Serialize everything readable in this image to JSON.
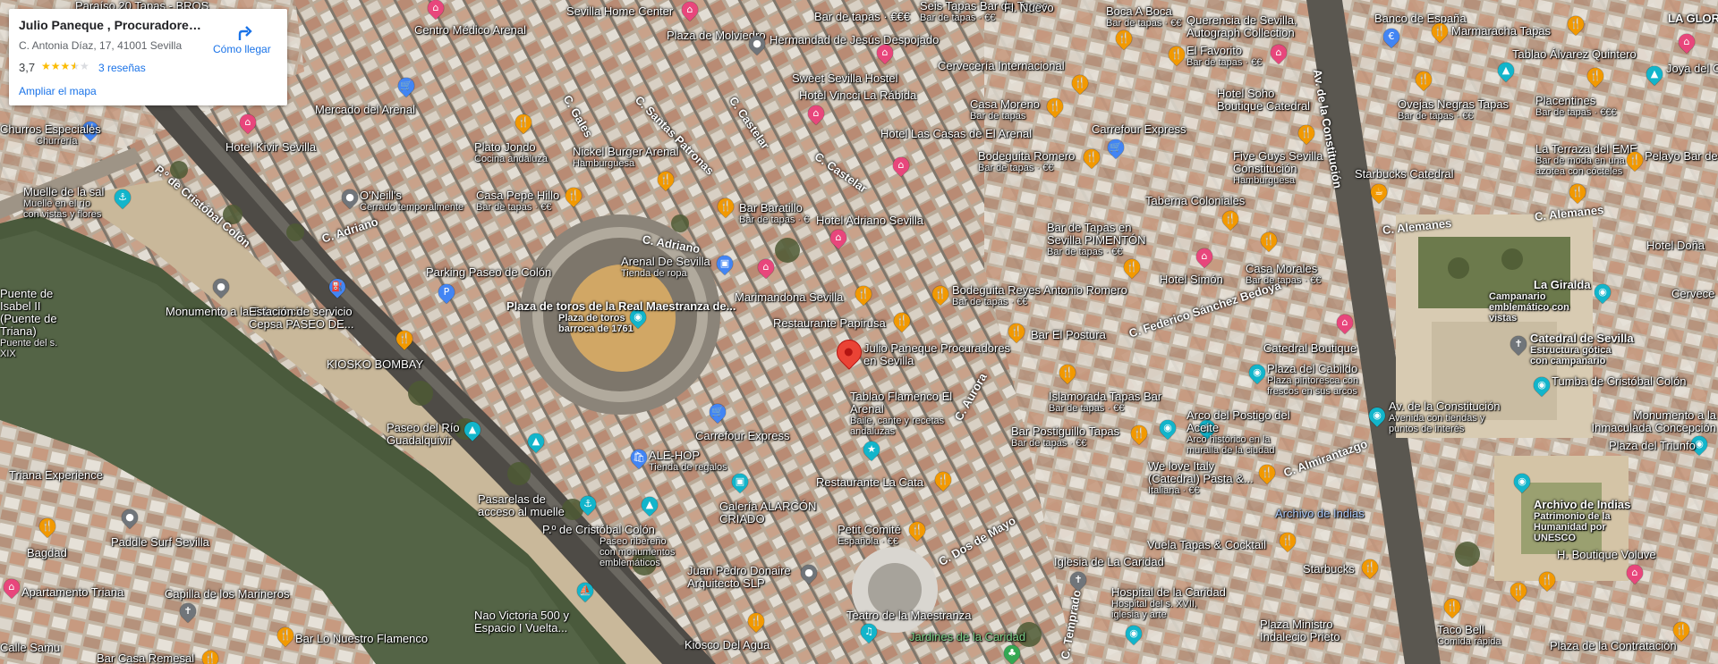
{
  "place_card": {
    "title": "Julio Paneque , Procuradores ...",
    "address": "C. Antonia Díaz, 17, 41001 Sevilla",
    "rating": "3,7",
    "stars_filled": 3.5,
    "reviews": "3 reseñas",
    "enlarge_map": "Ampliar el mapa",
    "directions": "Cómo llegar"
  },
  "colors": {
    "food_pin": "#f29900",
    "shop_pin": "#4285f4",
    "tourism_pin": "#12b5cb",
    "hotel_pin": "#e8467c",
    "generic_pin": "#70757a",
    "main_pin": "#ea4335"
  },
  "map": {
    "streets": [
      "P.º de Cristóbal Colón",
      "C. Adriano",
      "C. Adriano",
      "C. Gales",
      "C. Santas Patronas",
      "C. Castelar",
      "C. Castelar",
      "C. Federico Sánchez Bedoya",
      "Av. de la Constitución",
      "C. Alemanes",
      "C. Alemanes",
      "C. Dos de Mayo",
      "C. Aurora",
      "C. Almirantazgo",
      "C. Temprado"
    ],
    "places": [
      {
        "name": "Centro Médico Arenal",
        "sub": "",
        "icon": "generic"
      },
      {
        "name": "Sevilla Home Center",
        "sub": "",
        "icon": "hotel"
      },
      {
        "name": "Plaza de Molviedro",
        "sub": "",
        "icon": "generic"
      },
      {
        "name": "Hermandad de Jesús Despojado",
        "sub": "",
        "icon": "generic"
      },
      {
        "name": "Sweet Sevilla Hostel",
        "sub": "",
        "icon": "hotel"
      },
      {
        "name": "Hotel Vincci La Rábida",
        "sub": "",
        "icon": "hotel"
      },
      {
        "name": "Cervecería Internacional",
        "sub": "",
        "icon": "food"
      },
      {
        "name": "Casa Moreno",
        "sub": "Bar de tapas",
        "icon": "food"
      },
      {
        "name": "Hotel Las Casas de El Arenal",
        "sub": "",
        "icon": "hotel"
      },
      {
        "name": "Bodeguita Romero",
        "sub": "Bar de tapas · €€",
        "icon": "food"
      },
      {
        "name": "Carrefour Express",
        "sub": "",
        "icon": "shop"
      },
      {
        "name": "Mercado del Arenal",
        "sub": "",
        "icon": "shop"
      },
      {
        "name": "Hotel Kivir Sevilla",
        "sub": "",
        "icon": "hotel"
      },
      {
        "name": "Plato Jondo",
        "sub": "Cocina andaluza",
        "icon": "food"
      },
      {
        "name": "Nickel Burger Arenal",
        "sub": "Hamburguesa",
        "icon": "food"
      },
      {
        "name": "O'Neill's",
        "sub": "Cerrado temporalmente",
        "icon": "generic"
      },
      {
        "name": "Casa Pepe Hillo",
        "sub": "Bar de tapas · €€",
        "icon": "food"
      },
      {
        "name": "Bar Baratillo",
        "sub": "Bar de tapas · €",
        "icon": "food"
      },
      {
        "name": "Hotel Adriano Sevilla",
        "sub": "",
        "icon": "hotel"
      },
      {
        "name": "Parking Paseo de Colón",
        "sub": "",
        "icon": "shop"
      },
      {
        "name": "Arenal De Sevilla",
        "sub": "Tienda de ropa",
        "icon": "shop"
      },
      {
        "name": "Plaza de toros de la Real Maestranza de...",
        "sub": "Plaza de toros barroca de 1761",
        "icon": "tourism"
      },
      {
        "name": "Marimandona Sevilla",
        "sub": "",
        "icon": "hotel"
      },
      {
        "name": "Bodeguita Reyes Antonio Romero",
        "sub": "Bar de tapas · €€",
        "icon": "food"
      },
      {
        "name": "Restaurante Papirusa",
        "sub": "",
        "icon": "food"
      },
      {
        "name": "Bar El Postura",
        "sub": "",
        "icon": "food"
      },
      {
        "name": "Julio Paneque Procuradores en Sevilla",
        "sub": "",
        "icon": "main"
      },
      {
        "name": "Tablao Flamenco El Arenal",
        "sub": "Baile, cante y recetas andaluzas",
        "icon": "tourism"
      },
      {
        "name": "Carrefour Express",
        "sub": "",
        "icon": "shop"
      },
      {
        "name": "ALE-HOP",
        "sub": "Tienda de regalos",
        "icon": "shop"
      },
      {
        "name": "Restaurante La Cata",
        "sub": "",
        "icon": "food"
      },
      {
        "name": "Galería ALARCÓN CRIADO",
        "sub": "",
        "icon": "tourism"
      },
      {
        "name": "Petit Comité",
        "sub": "Española · €€",
        "icon": "food"
      },
      {
        "name": "Monumento a la Tolerancia",
        "sub": "",
        "icon": "generic"
      },
      {
        "name": "Estación de servicio Cepsa PASEO DE...",
        "sub": "",
        "icon": "shop"
      },
      {
        "name": "KIOSKO BOMBAY",
        "sub": "",
        "icon": "food"
      },
      {
        "name": "Paseo del Río Guadalquivir",
        "sub": "",
        "icon": "tourism"
      },
      {
        "name": "Pasarelas de acceso al muelle",
        "sub": "",
        "icon": "tourism"
      },
      {
        "name": "P.º de Cristóbal Colón",
        "sub": "Paseo ribereño con monumentos emblemáticos",
        "icon": "tourism"
      },
      {
        "name": "Juan Pedro Donaire Arquitecto SLP",
        "sub": "",
        "icon": "generic"
      },
      {
        "name": "Kiosco Del Agua",
        "sub": "",
        "icon": "food"
      },
      {
        "name": "Teatro de la Maestranza",
        "sub": "",
        "icon": "tourism"
      },
      {
        "name": "Jardines de la Caridad",
        "sub": "",
        "icon": "park"
      },
      {
        "name": "Nao Victoria 500 y Espacio I Vuelta...",
        "sub": "",
        "icon": "tourism"
      },
      {
        "name": "Muelle de la sal",
        "sub": "Muelle en el río con vistas y flores",
        "icon": "tourism"
      },
      {
        "name": "Puente de Isabel II (Puente de Triana)",
        "sub": "Puente del s. XIX",
        "icon": "tourism"
      },
      {
        "name": "Paddle Surf Sevilla",
        "sub": "",
        "icon": "generic"
      },
      {
        "name": "Apartamento Triana",
        "sub": "",
        "icon": "hotel"
      },
      {
        "name": "Capilla de los Marineros",
        "sub": "",
        "icon": "generic"
      },
      {
        "name": "Bar Lo Nuestro Flamenco",
        "sub": "",
        "icon": "food"
      },
      {
        "name": "Bar Casa Remesal",
        "sub": "",
        "icon": "food"
      },
      {
        "name": "Triana Experience",
        "sub": "",
        "icon": "tourism"
      },
      {
        "name": "Bagdad",
        "sub": "",
        "icon": "food"
      },
      {
        "name": "Churros Especiales",
        "sub": "Churrería",
        "icon": "food"
      },
      {
        "name": "Boca A Boca",
        "sub": "Bar de tapas · €€",
        "icon": "food"
      },
      {
        "name": "Querencia de Sevilla, Autograph Collection",
        "sub": "",
        "icon": "hotel"
      },
      {
        "name": "El Favorito",
        "sub": "Bar de tapas · €€",
        "icon": "food"
      },
      {
        "name": "Hotel Soho Boutique Catedral",
        "sub": "",
        "icon": "hotel"
      },
      {
        "name": "Five Guys Sevilla Constitución",
        "sub": "Hamburguesa",
        "icon": "food"
      },
      {
        "name": "Taberna Coloniales",
        "sub": "",
        "icon": "food"
      },
      {
        "name": "Bar de Tapas en Sevilla PIMENTÓN",
        "sub": "Bar de tapas · €€",
        "icon": "food"
      },
      {
        "name": "Casa Morales",
        "sub": "Bar de tapas · €€",
        "icon": "food"
      },
      {
        "name": "Hotel Simón",
        "sub": "",
        "icon": "hotel"
      },
      {
        "name": "Catedral Boutique",
        "sub": "",
        "icon": "hotel"
      },
      {
        "name": "Plaza del Cabildo",
        "sub": "Plaza pintoresca con frescos en sus arcos",
        "icon": "tourism"
      },
      {
        "name": "Islamorada Tapas Bar",
        "sub": "Bar de tapas · €€",
        "icon": "food"
      },
      {
        "name": "Bar Postiguillo Tapas",
        "sub": "Bar de tapas · €€",
        "icon": "food"
      },
      {
        "name": "Arco del Postigo del Aceite",
        "sub": "Arco histórico en la muralla de la ciudad",
        "icon": "tourism"
      },
      {
        "name": "We love Italy (Catedral) Pasta &...",
        "sub": "Italiana · €€",
        "icon": "food"
      },
      {
        "name": "Archivo de Indias",
        "sub": "",
        "icon": "tourism"
      },
      {
        "name": "Vuela Tapas & Cocktail",
        "sub": "",
        "icon": "food"
      },
      {
        "name": "Iglesia de La Caridad",
        "sub": "",
        "icon": "generic"
      },
      {
        "name": "Hospital de la Caridad",
        "sub": "Hospital del s. XVII, iglesia y arte",
        "icon": "tourism"
      },
      {
        "name": "Starbucks",
        "sub": "",
        "icon": "food"
      },
      {
        "name": "Plaza Ministro Indalecio Prieto",
        "sub": "",
        "icon": "generic"
      },
      {
        "name": "Banco de España",
        "sub": "",
        "icon": "generic"
      },
      {
        "name": "Marmaracha Tapas",
        "sub": "",
        "icon": "food"
      },
      {
        "name": "Tablao Álvarez Quintero",
        "sub": "",
        "icon": "tourism"
      },
      {
        "name": "Ovejas Negras Tapas",
        "sub": "Bar de tapas · €€",
        "icon": "food"
      },
      {
        "name": "Placentines",
        "sub": "Bar de tapas · €€€",
        "icon": "food"
      },
      {
        "name": "Starbucks Catedral",
        "sub": "",
        "icon": "food"
      },
      {
        "name": "La Terraza del EME",
        "sub": "Bar de moda en una azotea con cócteles",
        "icon": "food"
      },
      {
        "name": "Pelayo Bar de",
        "sub": "",
        "icon": "food"
      },
      {
        "name": "La Giralda",
        "sub": "Campanario emblemático con vistas",
        "icon": "tourism"
      },
      {
        "name": "Catedral de Sevilla",
        "sub": "Estructura gótica con campanario",
        "icon": "tourism"
      },
      {
        "name": "Tumba de Cristóbal Colón",
        "sub": "",
        "icon": "tourism"
      },
      {
        "name": "Av. de la Constitución",
        "sub": "Avenida con tiendas y puntos de interés",
        "icon": "tourism"
      },
      {
        "name": "Monumento a la Inmaculada Concepción",
        "sub": "",
        "icon": "tourism"
      },
      {
        "name": "Plaza del Triunfo",
        "sub": "",
        "icon": "generic"
      },
      {
        "name": "Archivo de Indias",
        "sub": "Patrimonio de la Humanidad por UNESCO",
        "icon": "tourism"
      },
      {
        "name": "H. Boutique Voluve",
        "sub": "",
        "icon": "hotel"
      },
      {
        "name": "Taco Bell",
        "sub": "Comida rápida",
        "icon": "food"
      },
      {
        "name": "Plaza de la Contratación",
        "sub": "",
        "icon": "generic"
      },
      {
        "name": "Joya del Ces",
        "sub": "",
        "icon": "tourism"
      },
      {
        "name": "LA GLORI",
        "sub": "",
        "icon": "food"
      },
      {
        "name": "Cervece",
        "sub": "",
        "icon": "food"
      },
      {
        "name": "Hotel Doña",
        "sub": "",
        "icon": "hotel"
      },
      {
        "name": "Seis Tapas Bar de Tapas",
        "sub": "Bar de tapas · €€",
        "icon": "food"
      },
      {
        "name": "Fl. Nuevo",
        "sub": "",
        "icon": "hotel"
      },
      {
        "name": "Bar de tapas · €€€",
        "sub": "",
        "icon": "food"
      },
      {
        "name": "Paraíso 20 Tapas - BROS",
        "sub": "",
        "icon": "food"
      },
      {
        "name": "Calle Samu",
        "sub": "",
        "icon": "generic"
      }
    ]
  }
}
